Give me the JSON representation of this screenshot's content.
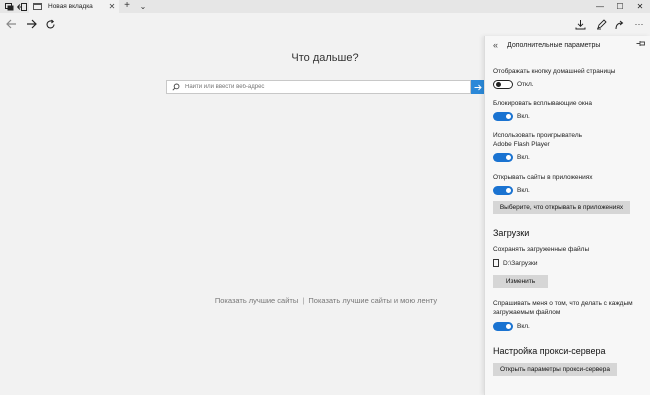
{
  "tabs": [
    {
      "title": "Новая вкладка"
    }
  ],
  "nav": {
    "back": "back-arrow",
    "forward": "forward-arrow",
    "refresh": "refresh-icon"
  },
  "main": {
    "title": "Что дальше?",
    "search_placeholder": "Найти или ввести веб-адрес",
    "link_top_sites": "Показать лучшие сайты",
    "link_top_sites_and_feed": "Показать лучшие сайты и мою ленту",
    "separator": "|"
  },
  "panel": {
    "title": "Дополнительные параметры",
    "settings": {
      "home_button_label": "Отображать кнопку домашней страницы",
      "home_button_state": "Откл.",
      "popups_label": "Блокировать всплывающие окна",
      "popups_state": "Вкл.",
      "flash_label_line1": "Использовать проигрыватель",
      "flash_label_line2": "Adobe Flash Player",
      "flash_state": "Вкл.",
      "apps_label": "Открывать сайты в приложениях",
      "apps_state": "Вкл.",
      "apps_button": "Выберите, что открывать в приложениях"
    },
    "downloads": {
      "heading": "Загрузки",
      "save_label": "Сохранять загруженные файлы",
      "folder": "D:\\Загрузки",
      "change_button": "Изменить",
      "ask_label_line1": "Спрашивать меня о том, что делать с каждым",
      "ask_label_line2": "загружаемым файлом",
      "ask_state": "Вкл."
    },
    "proxy": {
      "heading": "Настройка прокси-сервера",
      "open_button": "Открыть параметры прокси-сервера"
    }
  },
  "colors": {
    "accent": "#1a73d1",
    "search_button": "#2b88d8",
    "page_bg": "#f2f2f2"
  }
}
